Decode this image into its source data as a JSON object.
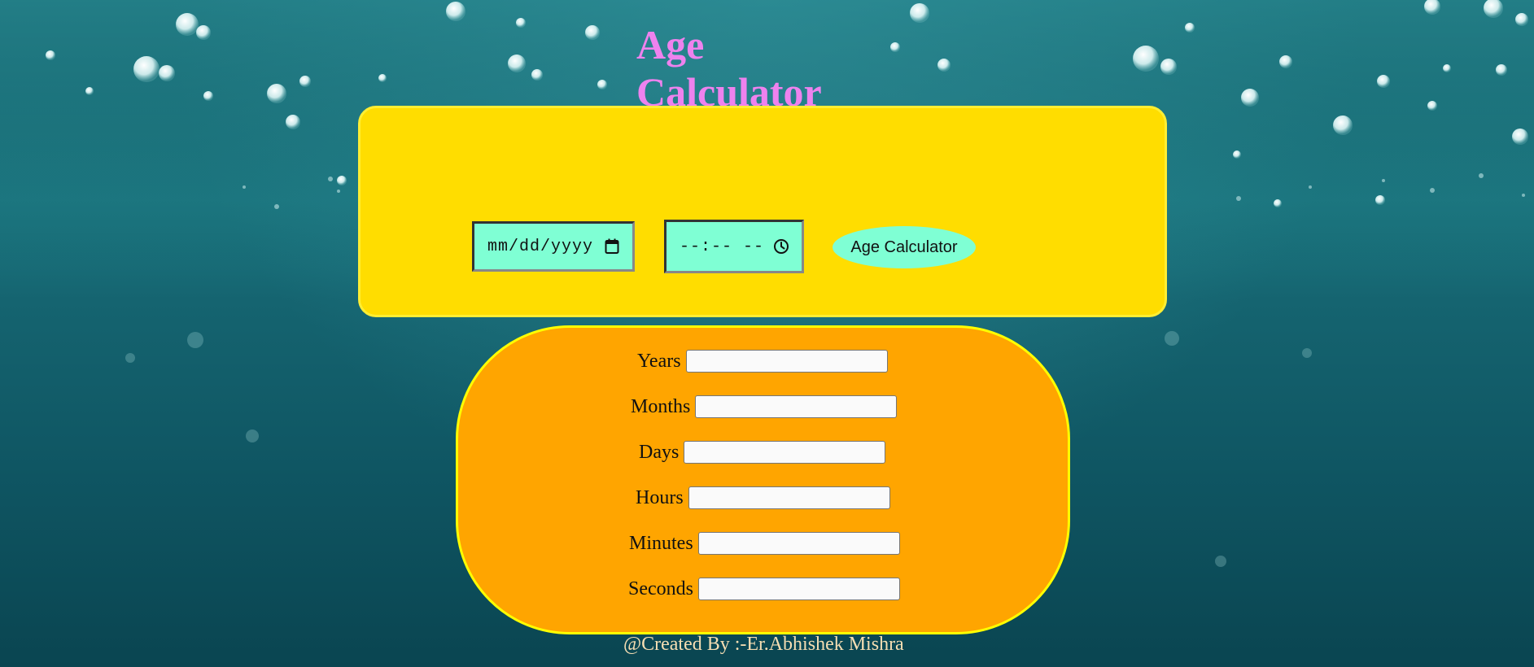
{
  "header": {
    "title": "Age Calculator"
  },
  "form": {
    "date_placeholder": "mm/dd/yyyy",
    "time_placeholder": "--:-- --",
    "calculate_label": "Age Calculator"
  },
  "results": {
    "rows": [
      {
        "label": "Years",
        "value": ""
      },
      {
        "label": "Months",
        "value": ""
      },
      {
        "label": "Days",
        "value": ""
      },
      {
        "label": "Hours",
        "value": ""
      },
      {
        "label": "Minutes",
        "value": ""
      },
      {
        "label": "Seconds",
        "value": ""
      }
    ]
  },
  "footer": {
    "credit": "@Created By :-Er.Abhishek Mishra"
  },
  "colors": {
    "title": "#ee82ee",
    "input_panel": "#ffdd00",
    "result_panel": "#ffa500",
    "input_fill": "#7fffd4",
    "footer_text": "#f5deb3"
  },
  "icons": {
    "date": "calendar-icon",
    "time": "clock-icon"
  }
}
